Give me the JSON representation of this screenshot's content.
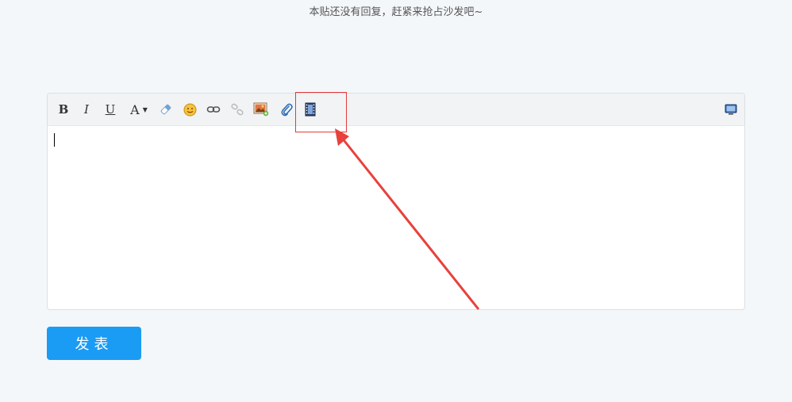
{
  "topic": {
    "no_reply_text": "本贴还没有回复，赶紧来抢占沙发吧~"
  },
  "toolbar": {
    "bold_label": "B",
    "italic_label": "I",
    "underline_label": "U",
    "font_color_label": "A",
    "icons": [
      "bold-icon",
      "italic-icon",
      "underline-icon",
      "font-color-icon",
      "eraser-icon",
      "smiley-icon",
      "link-icon",
      "unlink-icon",
      "image-icon",
      "attachment-icon",
      "video-icon",
      "source-view-icon"
    ]
  },
  "editor": {
    "content": ""
  },
  "annotation": {
    "highlight_color": "#e23b3b",
    "target": "video-icon"
  },
  "submit": {
    "label": "发表",
    "color": "#1a9cf5"
  }
}
